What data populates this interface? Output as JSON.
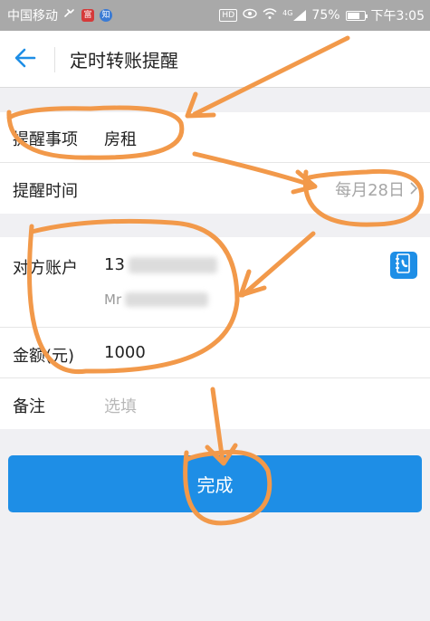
{
  "status_bar": {
    "carrier": "中国移动",
    "badge_1": "富",
    "badge_2": "知",
    "hd": "HD",
    "network": "4G",
    "battery_percent": "75%",
    "battery_level": 0.75,
    "time": "下午3:05"
  },
  "header": {
    "title": "定时转账提醒"
  },
  "form": {
    "reminder_item": {
      "label": "提醒事项",
      "value": "房租"
    },
    "reminder_time": {
      "label": "提醒时间",
      "value": "每月28日"
    },
    "counterparty": {
      "label": "对方账户",
      "account_prefix": "13",
      "name_prefix": "Mr"
    },
    "amount": {
      "label": "金额(元)",
      "value": "1000"
    },
    "note": {
      "label": "备注",
      "placeholder": "选填"
    }
  },
  "actions": {
    "done_label": "完成"
  },
  "colors": {
    "accent": "#1e8ee6",
    "annotation": "#f2994a",
    "status_bar": "#a9a9a9"
  }
}
